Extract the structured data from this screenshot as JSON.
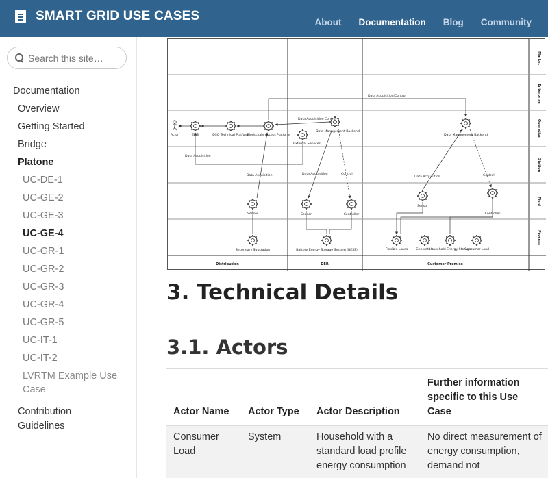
{
  "header": {
    "title": "SMART GRID USE CASES",
    "nav": [
      {
        "label": "About",
        "active": false
      },
      {
        "label": "Documentation",
        "active": true
      },
      {
        "label": "Blog",
        "active": false
      },
      {
        "label": "Community",
        "active": false
      }
    ]
  },
  "sidebar": {
    "search_placeholder": "Search this site…",
    "items": [
      "Documentation",
      "Overview",
      "Getting Started",
      "Bridge",
      "Platone",
      "UC-DE-1",
      "UC-GE-2",
      "UC-GE-3",
      "UC-GE-4",
      "UC-GR-1",
      "UC-GR-2",
      "UC-GR-3",
      "UC-GR-4",
      "UC-GR-5",
      "UC-IT-1",
      "UC-IT-2",
      "LVRTM Example Use Case",
      "Contribution Guidelines"
    ]
  },
  "diagram": {
    "zones": [
      "Distribution",
      "DER",
      "Customer Premise"
    ],
    "layers": [
      "Market",
      "Enterprise",
      "Operation",
      "Station",
      "Field",
      "Process"
    ],
    "nodes": {
      "actor": "Actor",
      "ems": "EMS",
      "dso": "DSO Technical Platform",
      "blockchain": "Blockchain Access Platform",
      "external": "External Services",
      "dmb_der": "Data Management Backend",
      "dmb_cust": "Data Management Backend",
      "sensor_dist": "Sensor",
      "secondary": "Secondary Substation",
      "sensor_der": "Sensor",
      "controller_der": "Controller",
      "bess": "Battery Energy Storage System (BESS)",
      "sensor_cust": "Sensor",
      "controller_cust": "Controller",
      "flexible": "Flexible Loads",
      "generators": "Generators",
      "household": "Household Energy Storage",
      "consumer": "Consumer Load"
    },
    "labels": {
      "acq_control_top": "Data Acquisition/Control",
      "acq_control_der": "Data Acquisition Control",
      "acq_ems": "Data Acquisition",
      "acq_dist": "Data Acquisition",
      "acq_der": "Data Acquisition",
      "control_der": "Control",
      "acq_cust": "Data Acquisition",
      "control_cust": "Control"
    }
  },
  "content": {
    "h2": "3. Technical Details",
    "h3": "3.1. Actors"
  },
  "table": {
    "headers": [
      "Actor Name",
      "Actor Type",
      "Actor Description",
      "Further information specific to this Use Case"
    ],
    "rows": [
      [
        "Consumer Load",
        "System",
        "Household with a standard load profile energy consumption",
        "No direct measurement of energy consumption, demand not"
      ]
    ]
  }
}
